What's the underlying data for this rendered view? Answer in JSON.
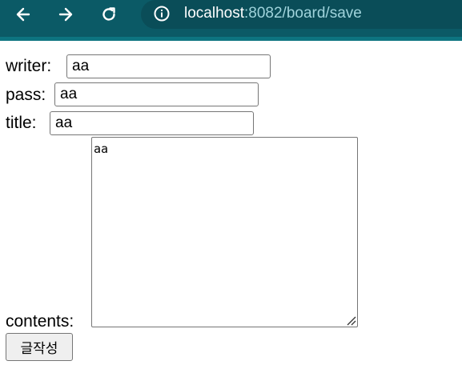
{
  "browser": {
    "url_host": "localhost",
    "url_path": ":8082/board/save",
    "colors": {
      "toolbar": "#0b5a66",
      "address_bar": "#0a4d58"
    }
  },
  "form": {
    "writer_label": "writer:",
    "writer_value": "aa",
    "pass_label": "pass:",
    "pass_value": "aa",
    "title_label": "title:",
    "title_value": "aa",
    "contents_label": "contents:",
    "contents_value": "aa",
    "submit_label": "글작성"
  }
}
